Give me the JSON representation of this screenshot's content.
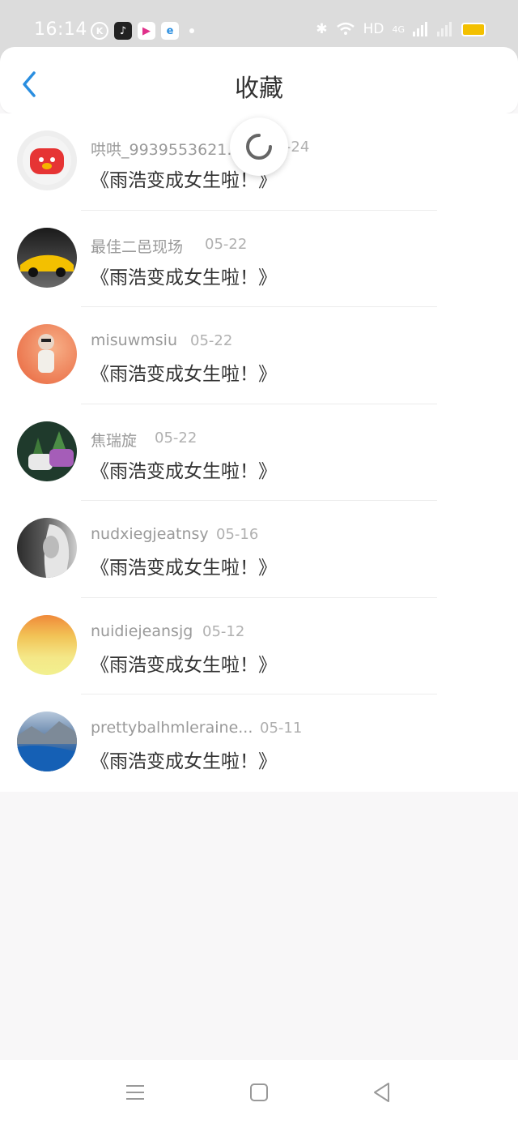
{
  "status_bar": {
    "time": "16:14",
    "network": "HD",
    "signal_label": "4G",
    "app_icons": [
      "k-app-icon",
      "tiktok-icon",
      "video-app-icon",
      "browser-icon"
    ],
    "battery_color": "#f3c000"
  },
  "header": {
    "title": "收藏",
    "back_icon": "chevron-left-icon"
  },
  "favorites": [
    {
      "user": "哄哄_9939553621...",
      "date": "05-24",
      "title": "《雨浩变成女生啦！》"
    },
    {
      "user": "最佳二邑现场",
      "date": "05-22",
      "title": "《雨浩变成女生啦！》"
    },
    {
      "user": "misuwmsiu",
      "date": "05-22",
      "title": "《雨浩变成女生啦！》"
    },
    {
      "user": "焦瑞旋",
      "date": "05-22",
      "title": "《雨浩变成女生啦！》"
    },
    {
      "user": "nudxiegjeatnsy",
      "date": "05-16",
      "title": "《雨浩变成女生啦！》"
    },
    {
      "user": "nuidiejeansjg",
      "date": "05-12",
      "title": "《雨浩变成女生啦！》"
    },
    {
      "user": "prettybalhmleraine...",
      "date": "05-11",
      "title": "《雨浩变成女生啦！》"
    }
  ],
  "nav_bar": {
    "menu_icon": "menu-icon",
    "home_icon": "home-square-icon",
    "back_icon": "back-triangle-icon"
  },
  "accent_color": "#2a8ee0"
}
